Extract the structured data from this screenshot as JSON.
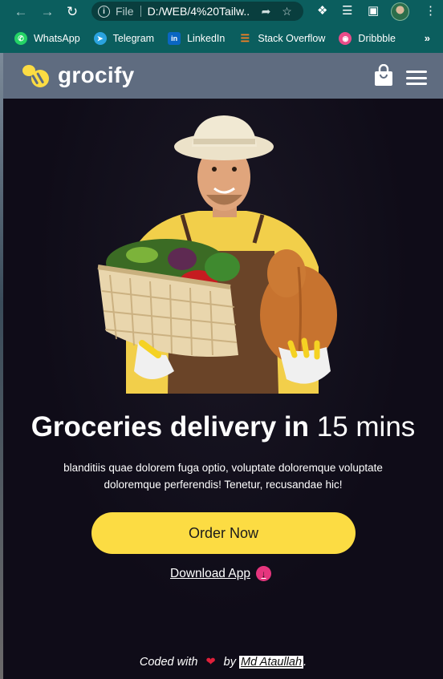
{
  "browser": {
    "omnibox_scheme": "File",
    "url": "D:/WEB/4%20Tailw...",
    "bookmarks": [
      {
        "label": "WhatsApp",
        "icon": "whatsapp-icon",
        "color": "#25d366"
      },
      {
        "label": "Telegram",
        "icon": "telegram-icon",
        "color": "#2aa3df"
      },
      {
        "label": "LinkedIn",
        "icon": "linkedin-icon",
        "color": "#0a66c2"
      },
      {
        "label": "Stack Overflow",
        "icon": "stackoverflow-icon",
        "color": "#f48024"
      },
      {
        "label": "Dribbble",
        "icon": "dribbble-icon",
        "color": "#ea4c89"
      }
    ],
    "more_label": "»"
  },
  "header": {
    "brand": "grocify",
    "brand_color": "#fcdc43",
    "bg_color": "#5f6c80"
  },
  "hero": {
    "headline_bold": "Groceries delivery in",
    "headline_light": "15 mins",
    "description": "blanditiis quae dolorem fuga optio, voluptate doloremque voluptate doloremque perferendis! Tenetur, recusandae hic!",
    "cta_label": "Order Now",
    "cta_color": "#fcdc43",
    "download_label": "Download App",
    "download_icon_color": "#e6357e"
  },
  "footer": {
    "prefix": "Coded with",
    "middle": "by",
    "author": "Md Ataullah",
    "suffix": "."
  }
}
